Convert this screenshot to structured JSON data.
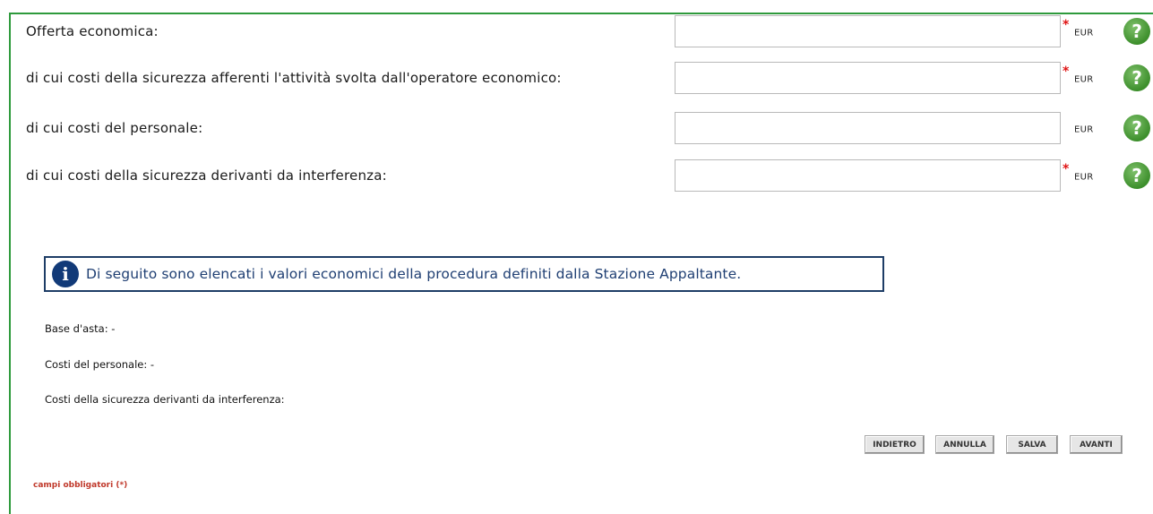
{
  "form": {
    "rows": [
      {
        "label": "Offerta economica:",
        "value": "",
        "required": "*",
        "unit": "EUR",
        "help": "?"
      },
      {
        "label": "di cui costi della sicurezza afferenti l'attività svolta dall'operatore economico:",
        "value": "",
        "required": "*",
        "unit": "EUR",
        "help": "?"
      },
      {
        "label": "di cui costi del personale:",
        "value": "",
        "required": "",
        "unit": "EUR",
        "help": "?"
      },
      {
        "label": "di cui costi della sicurezza derivanti da interferenza:",
        "value": "",
        "required": "*",
        "unit": "EUR",
        "help": "?"
      }
    ]
  },
  "info": {
    "icon_glyph": "i",
    "text": "Di seguito sono elencati i valori economici della procedura definiti dalla Stazione Appaltante."
  },
  "values": {
    "base_asta": "Base d'asta: -",
    "costi_personale": "Costi del personale: -",
    "costi_sicurezza": "Costi della sicurezza derivanti da interferenza:"
  },
  "buttons": {
    "back": "INDIETRO",
    "cancel": "ANNULLA",
    "save": "SALVA",
    "next": "AVANTI"
  },
  "footer": {
    "required_note": "campi obbligatori (*)"
  },
  "colors": {
    "frame": "#2e9a3c",
    "required": "#e01414",
    "info_border": "#1e3d66",
    "info_text": "#1f3f73",
    "help_icon": "#3d8f2c"
  },
  "icons": {
    "help": "question-circle-icon",
    "info": "info-circle-icon"
  }
}
